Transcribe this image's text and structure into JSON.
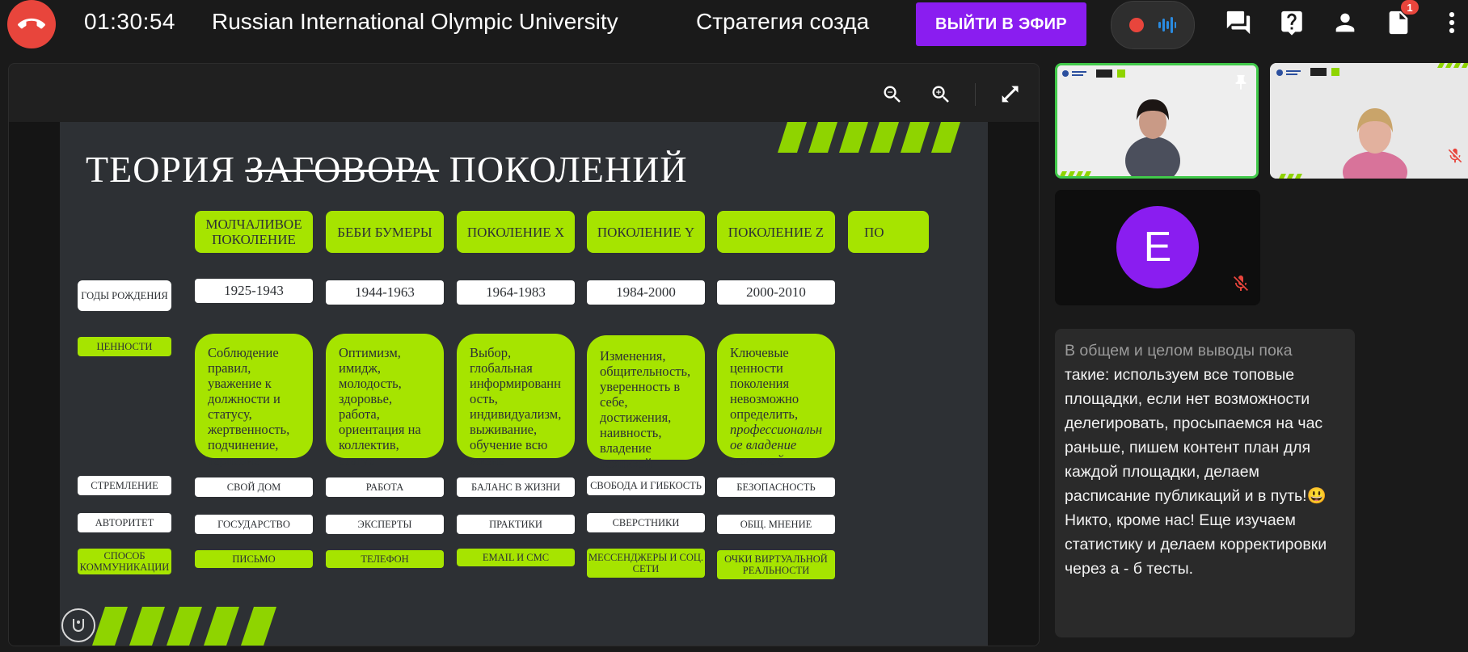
{
  "call": {
    "timer": "01:30:54",
    "room_title": "Russian International Olympic University",
    "room_subtitle": "Стратегия созда",
    "go_live_label": "ВЫЙТИ В ЭФИР",
    "notification_count": "1"
  },
  "slide": {
    "title_before": "ТЕОРИЯ",
    "title_struck": "ЗАГОВОРА",
    "title_after": "ПОКОЛЕНИЙ",
    "headers": [
      "МОЛЧАЛИВОЕ ПОКОЛЕНИЕ",
      "БЕБИ БУМЕРЫ",
      "ПОКОЛЕНИЕ X",
      "ПОКОЛЕНИЕ Y",
      "ПОКОЛЕНИЕ Z",
      "ПО"
    ],
    "row_labels": {
      "birth_years": "ГОДЫ РОЖДЕНИЯ",
      "values": "ЦЕННОСТИ",
      "aspiration": "СТРЕМЛЕНИЕ",
      "authority": "АВТОРИТЕТ",
      "communication": "СПОСОБ КОММУНИКАЦИИ"
    },
    "birth_years": [
      "1925-1943",
      "1944-1963",
      "1964-1983",
      "1984-2000",
      "2000-2010"
    ],
    "values": [
      "Соблюдение правил, уважение к должности и статусу, жертвенность, подчинение, терпение",
      "Оптимизм, имидж, молодость, здоровье, работа, ориентация на коллектив, статус",
      "Выбор, глобальная информированн ость, индивидуализм, выживание, обучение всю жизнь",
      "Изменения, общительность, уверенность в себе, достижения, наивность, владение техникой",
      "Ключевые ценности поколения невозможно определить,"
    ],
    "values_z_italic": "профессиональн ое владение техникой",
    "aspiration": [
      "СВОЙ ДОМ",
      "РАБОТА",
      "БАЛАНС В ЖИЗНИ",
      "СВОБОДА И ГИБКОСТЬ",
      "БЕЗОПАСНОСТЬ"
    ],
    "authority": [
      "ГОСУДАРСТВО",
      "ЭКСПЕРТЫ",
      "ПРАКТИКИ",
      "СВЕРСТНИКИ",
      "ОБЩ. МНЕНИЕ"
    ],
    "communication": [
      "ПИСЬМО",
      "ТЕЛЕФОН",
      "EMAIL И СМС",
      "МЕССЕНДЖЕРЫ И СОЦ. СЕТИ",
      "ОЧКИ ВИРТУАЛЬНОЙ РЕАЛЬНОСТИ"
    ]
  },
  "participants": {
    "avatar_letter": "E"
  },
  "chat": {
    "message_faded": "В общем и целом выводы пока",
    "message": "такие: используем все топовые площадки, если нет возможности делегировать, просыпаемся на час раньше, пишем контент план для каждой площадки, делаем расписание публикаций и в путь!😃 Никто, кроме нас! Еще изучаем статистику и делаем корректировки через а - б тесты."
  },
  "colors": {
    "accent_purple": "#8a1df0",
    "end_call_red": "#e8453c",
    "slide_green": "#a6e400",
    "slide_bg": "#2d3034",
    "active_speaker": "#41c94a"
  }
}
